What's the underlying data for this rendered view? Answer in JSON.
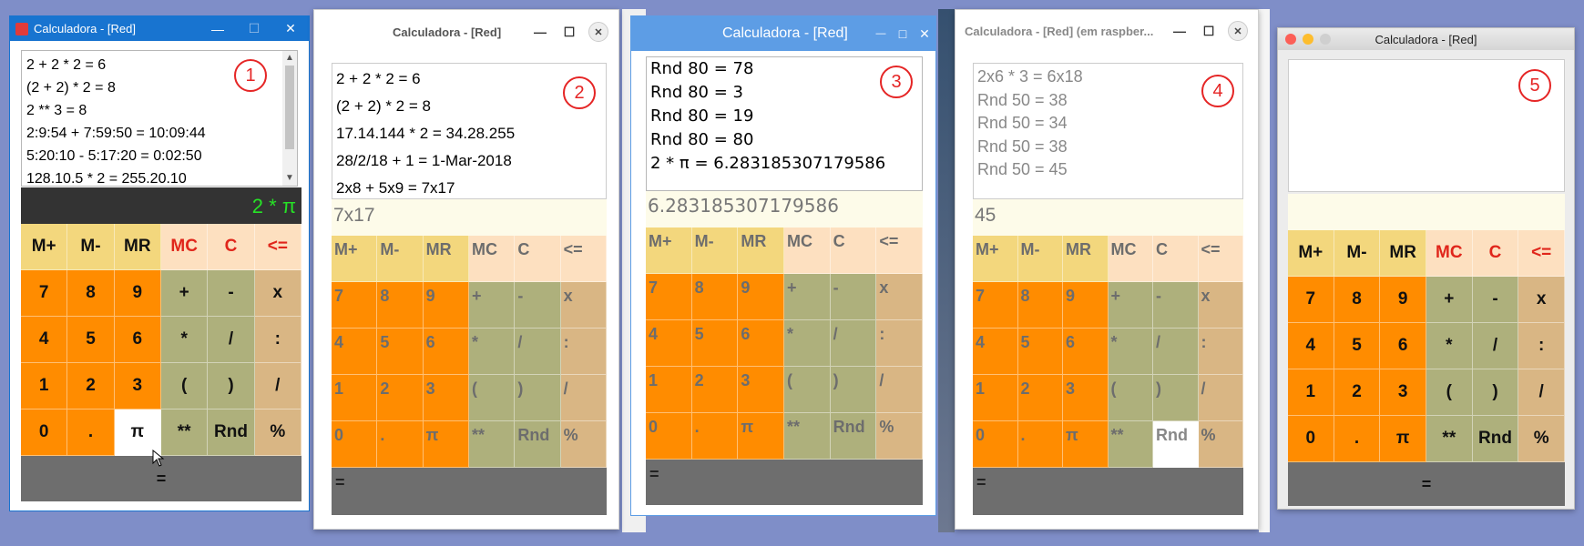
{
  "colors": {
    "memory_keys": "#f3d77d",
    "clear_keys": "#fde0c0",
    "digit_keys": "#ff8c00",
    "operator_keys": "#aeb07c",
    "division_keys": "#d9b684",
    "equals_bar": "#6e6e6e",
    "display_bg": "#fdfbe9",
    "red_text": "#e0261b",
    "win10_titlebar": "#1874d0",
    "raspbian_titlebar": "#5d9de5"
  },
  "labels": {
    "mem_plus": "M+",
    "mem_minus": "M-",
    "mem_recall": "MR",
    "mem_clear": "MC",
    "clear": "C",
    "backspace": "<=",
    "seven": "7",
    "eight": "8",
    "nine": "9",
    "plus": "+",
    "minus": "-",
    "times_x": "x",
    "four": "4",
    "five": "5",
    "six": "6",
    "star": "*",
    "slash": "/",
    "colon": ":",
    "one": "1",
    "two": "2",
    "three": "3",
    "lparen": "(",
    "rparen": ")",
    "slash2": "/",
    "zero": "0",
    "dot": ".",
    "pi": "π",
    "power": "**",
    "rnd": "Rnd",
    "percent": "%",
    "equals": "="
  },
  "windows": [
    {
      "title": "Calculadora - [Red]",
      "badge": "1",
      "history": [
        "2 + 2 * 2 = 6",
        "(2 + 2) * 2 = 8",
        "2 ** 3 = 8",
        "2:9:54 + 7:59:50 = 10:09:44",
        "5:20:10 - 5:17:20 = 0:02:50",
        "128.10.5 * 2 = 255.20.10"
      ],
      "display": "2 *  π",
      "controls": {
        "minimize": "—",
        "maximize": "☐",
        "close": "✕"
      }
    },
    {
      "title": "Calculadora - [Red]",
      "badge": "2",
      "history": [
        "2 + 2 * 2 = 6",
        "(2 + 2) * 2 = 8",
        "17.14.144 * 2 = 34.28.255",
        "28/2/18 + 1 = 1-Mar-2018",
        "2x8 + 5x9 = 7x17"
      ],
      "display": "7x17",
      "controls": {
        "minimize": "—",
        "maximize": "☐",
        "close": "✕"
      }
    },
    {
      "title": "Calculadora - [Red]",
      "badge": "3",
      "history": [
        "Rnd 80 = 78",
        "Rnd 80 = 3",
        "Rnd 80 = 19",
        "Rnd 80 = 80",
        "2 *  π  = 6.283185307179586"
      ],
      "display": "6.283185307179586",
      "controls": {
        "minimize": "—",
        "maximize": "□",
        "close": "✕"
      }
    },
    {
      "title": "Calculadora - [Red] (em raspber...",
      "badge": "4",
      "history": [
        "2x6 * 3 = 6x18",
        "Rnd 50 = 38",
        "Rnd 50 = 34",
        "Rnd 50 = 38",
        "Rnd 50 = 45"
      ],
      "display": "45",
      "controls": {
        "minimize": "—",
        "maximize": "☐",
        "close": "✕"
      }
    },
    {
      "title": "Calculadora - [Red]",
      "badge": "5",
      "history": [],
      "display": ""
    }
  ]
}
